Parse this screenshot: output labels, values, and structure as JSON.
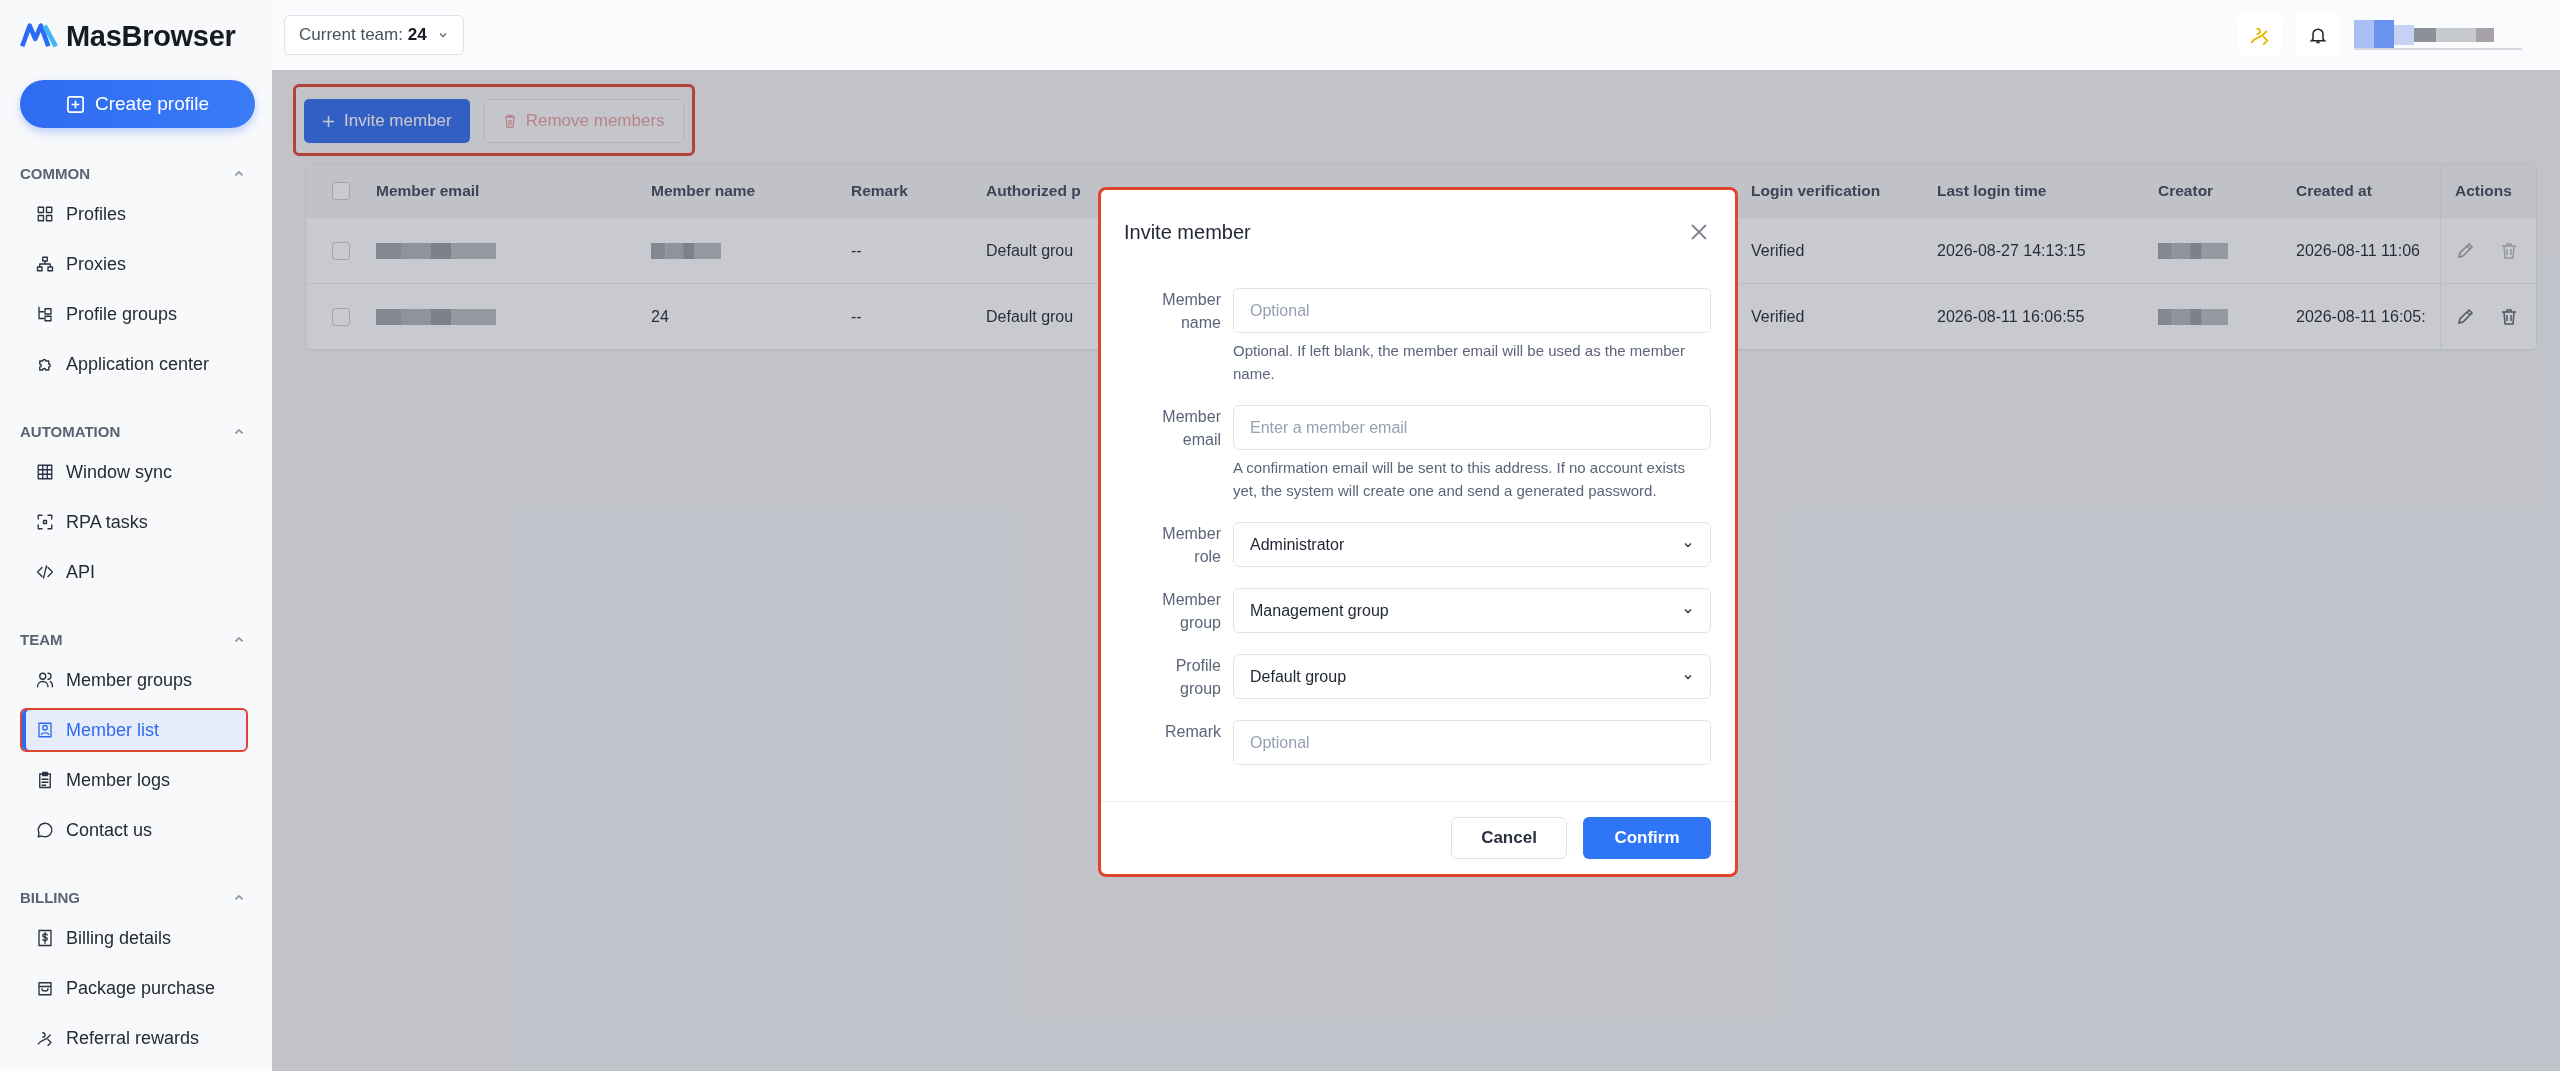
{
  "logo": {
    "name": "MasBrowser"
  },
  "create_button": {
    "label": "Create profile"
  },
  "sidebar": {
    "sections": [
      {
        "title": "COMMON",
        "expanded": true,
        "items": [
          {
            "label": "Profiles",
            "selected": false,
            "highlighted": false
          },
          {
            "label": "Proxies",
            "selected": false,
            "highlighted": false
          },
          {
            "label": "Profile groups",
            "selected": false,
            "highlighted": false
          },
          {
            "label": "Application center",
            "selected": false,
            "highlighted": false
          }
        ]
      },
      {
        "title": "AUTOMATION",
        "expanded": true,
        "items": [
          {
            "label": "Window sync",
            "selected": false,
            "highlighted": false
          },
          {
            "label": "RPA tasks",
            "selected": false,
            "highlighted": false
          },
          {
            "label": "API",
            "selected": false,
            "highlighted": false
          }
        ]
      },
      {
        "title": "TEAM",
        "expanded": true,
        "items": [
          {
            "label": "Member groups",
            "selected": false,
            "highlighted": false
          },
          {
            "label": "Member list",
            "selected": true,
            "highlighted": true
          },
          {
            "label": "Member logs",
            "selected": false,
            "highlighted": false
          },
          {
            "label": "Contact us",
            "selected": false,
            "highlighted": false
          }
        ]
      },
      {
        "title": "BILLING",
        "expanded": true,
        "items": [
          {
            "label": "Billing details",
            "selected": false,
            "highlighted": false
          },
          {
            "label": "Package purchase",
            "selected": false,
            "highlighted": false
          },
          {
            "label": "Referral rewards",
            "selected": false,
            "highlighted": false
          }
        ]
      }
    ]
  },
  "header": {
    "team_label": "Current team:",
    "team_value": "24"
  },
  "toolbar": {
    "highlighted": true,
    "buttons": [
      {
        "kind": "primary",
        "label": "Invite member",
        "disabled": false
      },
      {
        "kind": "danger",
        "label": "Remove members",
        "disabled": true
      }
    ]
  },
  "table": {
    "select_all_checked": false,
    "columns": [
      "Member email",
      "Member name",
      "Remark",
      "Authorized p",
      "Login verification",
      "Last login time",
      "Creator",
      "Created at",
      "Actions"
    ],
    "rows": [
      {
        "checked": false,
        "actions_disabled": true,
        "cells": [
          {
            "kind": "blurred"
          },
          {
            "kind": "blurred"
          },
          {
            "kind": "text",
            "text": "--"
          },
          {
            "kind": "text",
            "text": "Default grou"
          },
          {
            "kind": "text",
            "text": "Verified"
          },
          {
            "kind": "text",
            "text": "2026-08-27 14:13:15"
          },
          {
            "kind": "blurred"
          },
          {
            "kind": "text",
            "text": "2026-08-11 11:06"
          }
        ]
      },
      {
        "checked": false,
        "actions_disabled": false,
        "cells": [
          {
            "kind": "blurred"
          },
          {
            "kind": "text",
            "text": "24"
          },
          {
            "kind": "text",
            "text": "--"
          },
          {
            "kind": "text",
            "text": "Default grou"
          },
          {
            "kind": "text",
            "text": "Verified"
          },
          {
            "kind": "text",
            "text": "2026-08-11 16:06:55"
          },
          {
            "kind": "blurred"
          },
          {
            "kind": "text",
            "text": "2026-08-11 16:05:"
          }
        ]
      }
    ]
  },
  "dialog": {
    "title": "Invite member",
    "highlighted": true,
    "fields": [
      {
        "kind": "input",
        "label": "Member name",
        "placeholder": "Optional",
        "hint": "Optional. If left blank, the member email will be used as the member name."
      },
      {
        "kind": "input",
        "label": "Member email",
        "placeholder": "Enter a member email",
        "hint": "A confirmation email will be sent to this address. If no account exists yet, the system will create one and send a generated password."
      },
      {
        "kind": "select",
        "label": "Member role",
        "value": "Administrator"
      },
      {
        "kind": "select",
        "label": "Member group",
        "value": "Management group"
      },
      {
        "kind": "select",
        "label": "Profile group",
        "value": "Default group"
      },
      {
        "kind": "input",
        "label": "Remark",
        "placeholder": "Optional"
      }
    ],
    "buttons": [
      {
        "kind": "secondary",
        "label": "Cancel"
      },
      {
        "kind": "primary",
        "label": "Confirm"
      }
    ]
  }
}
